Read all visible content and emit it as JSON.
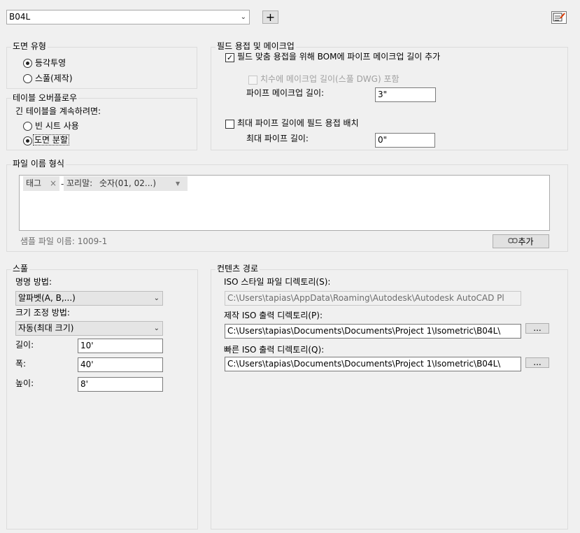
{
  "top": {
    "config_value": "B04L",
    "add_button": "+"
  },
  "drawing_type": {
    "title": "도면 유형",
    "option_isometric": "등각투영",
    "option_spool": "스풀(제작)",
    "selected": "등각투영"
  },
  "table_overflow": {
    "title": "테이블 오버플로우",
    "prompt": "긴 테이블을 계속하려면:",
    "option_new_sheet": "빈 시트 사용",
    "option_split": "도면 분할",
    "selected": "도면 분할"
  },
  "field_weld": {
    "title": "필드 용접 및 메이크업",
    "add_makeup_label": "필드 맞춤 용접을 위해 BOM에 파이프 메이크업 길이 추가",
    "add_makeup_checked": true,
    "include_dim_label": "치수에 메이크업 길이(스풀 DWG) 포함",
    "makeup_length_label": "파이프 메이크업 길이:",
    "makeup_length_value": "3\"",
    "max_pipe_label": "최대 파이프 길이에 필드 용접 배치",
    "max_pipe_checked": false,
    "max_length_label": "최대 파이프 길이:",
    "max_length_value": "0\""
  },
  "file_name_format": {
    "title": "파일 이름 형식",
    "tag_chip": "태그",
    "remove_glyph": "×",
    "separator": "-",
    "suffix_label": "꼬리말:",
    "suffix_value": "숫자(01, 02...)",
    "sample_label": "샘플 파일 이름: 1009-1",
    "add_button": "추가"
  },
  "spool": {
    "title": "스풀",
    "naming_label": "명명 방법:",
    "naming_value": "알파벳(A, B,...)",
    "sizing_label": "크기 조정 방법:",
    "sizing_value": "자동(최대 크기)",
    "length_label": "길이:",
    "length_value": "10'",
    "width_label": "폭:",
    "width_value": "40'",
    "height_label": "높이:",
    "height_value": "8'"
  },
  "content_path": {
    "title": "컨텐츠 경로",
    "style_dir_label": "ISO 스타일 파일 디렉토리(S):",
    "style_dir_value": "C:\\Users\\tapias\\AppData\\Roaming\\Autodesk\\Autodesk AutoCAD Pl",
    "prod_dir_label": "제작 ISO 출력 디렉토리(P):",
    "prod_dir_value": "C:\\Users\\tapias\\Documents\\Documents\\Project 1\\Isometric\\B04L\\",
    "quick_dir_label": "빠른 ISO 출력 디렉토리(Q):",
    "quick_dir_value": "C:\\Users\\tapias\\Documents\\Documents\\Project 1\\Isometric\\B04L\\",
    "browse_label": "..."
  },
  "icons": {
    "report_icon": "report-edit-icon",
    "chain_icon": "link-chain-icon",
    "dropdown_icon": "chevron-down-icon"
  }
}
